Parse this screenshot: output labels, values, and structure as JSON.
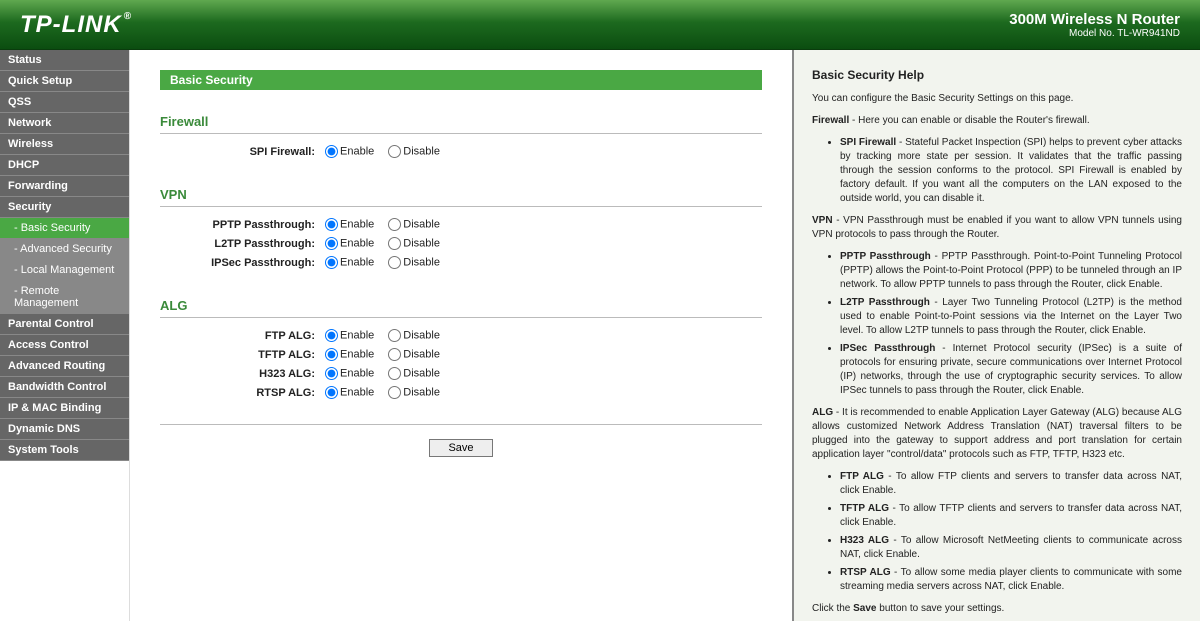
{
  "header": {
    "logo_text": "TP-LINK",
    "reg": "®",
    "product_name": "300M Wireless N Router",
    "model_no": "Model No. TL-WR941ND"
  },
  "sidebar": {
    "items": [
      {
        "label": "Status"
      },
      {
        "label": "Quick Setup"
      },
      {
        "label": "QSS"
      },
      {
        "label": "Network"
      },
      {
        "label": "Wireless"
      },
      {
        "label": "DHCP"
      },
      {
        "label": "Forwarding"
      },
      {
        "label": "Security"
      },
      {
        "label": "- Basic Security",
        "sub": true,
        "active": true
      },
      {
        "label": "- Advanced Security",
        "sub": true
      },
      {
        "label": "- Local Management",
        "sub": true
      },
      {
        "label": "- Remote Management",
        "sub": true
      },
      {
        "label": "Parental Control"
      },
      {
        "label": "Access Control"
      },
      {
        "label": "Advanced Routing"
      },
      {
        "label": "Bandwidth Control"
      },
      {
        "label": "IP & MAC Binding"
      },
      {
        "label": "Dynamic DNS"
      },
      {
        "label": "System Tools"
      }
    ]
  },
  "main": {
    "page_title": "Basic Security",
    "enable_label": "Enable",
    "disable_label": "Disable",
    "save_label": "Save",
    "sections": [
      {
        "title": "Firewall",
        "rows": [
          {
            "label": "SPI Firewall:",
            "key": "spi",
            "value": "enable"
          }
        ]
      },
      {
        "title": "VPN",
        "rows": [
          {
            "label": "PPTP Passthrough:",
            "key": "pptp",
            "value": "enable"
          },
          {
            "label": "L2TP Passthrough:",
            "key": "l2tp",
            "value": "enable"
          },
          {
            "label": "IPSec Passthrough:",
            "key": "ipsec",
            "value": "enable"
          }
        ]
      },
      {
        "title": "ALG",
        "rows": [
          {
            "label": "FTP ALG:",
            "key": "ftp",
            "value": "enable"
          },
          {
            "label": "TFTP ALG:",
            "key": "tftp",
            "value": "enable"
          },
          {
            "label": "H323 ALG:",
            "key": "h323",
            "value": "enable"
          },
          {
            "label": "RTSP ALG:",
            "key": "rtsp",
            "value": "enable"
          }
        ]
      }
    ]
  },
  "help": {
    "title": "Basic Security Help",
    "intro": "You can configure the Basic Security Settings on this page.",
    "firewall_label": "Firewall",
    "firewall_text": " - Here you can enable or disable the Router's firewall.",
    "spi_label": "SPI Firewall",
    "spi_text": " - Stateful Packet Inspection (SPI) helps to prevent cyber attacks by tracking more state per session. It validates that the traffic passing through the session conforms to the protocol. SPI Firewall is enabled by factory default. If you want all the computers on the LAN exposed to the outside world, you can disable it.",
    "vpn_label": "VPN",
    "vpn_text": " - VPN Passthrough must be enabled if you want to allow VPN tunnels using VPN protocols to pass through the Router.",
    "pptp_label": "PPTP Passthrough",
    "pptp_text": " - PPTP Passthrough. Point-to-Point Tunneling Protocol (PPTP) allows the Point-to-Point Protocol (PPP) to be tunneled through an IP network. To allow PPTP tunnels to pass through the Router, click Enable.",
    "l2tp_label": "L2TP Passthrough",
    "l2tp_text": " - Layer Two Tunneling Protocol (L2TP) is the method used to enable Point-to-Point sessions via the Internet on the Layer Two level. To allow L2TP tunnels to pass through the Router, click Enable.",
    "ipsec_label": "IPSec Passthrough",
    "ipsec_text": " - Internet Protocol security (IPSec) is a suite of protocols for ensuring private, secure communications over Internet Protocol (IP) networks, through the use of cryptographic security services. To allow IPSec tunnels to pass through the Router, click Enable.",
    "alg_label": "ALG",
    "alg_text": " - It is recommended to enable Application Layer Gateway (ALG) because ALG allows customized Network Address Translation (NAT) traversal filters to be plugged into the gateway to support address and port translation for certain application layer \"control/data\" protocols such as FTP, TFTP, H323 etc.",
    "ftp_label": "FTP ALG",
    "ftp_text": " - To allow FTP clients and servers to transfer data across NAT, click Enable.",
    "tftp_label": "TFTP ALG",
    "tftp_text": " - To allow TFTP clients and servers to transfer data across NAT, click Enable.",
    "h323_label": "H323 ALG",
    "h323_text": " - To allow Microsoft NetMeeting clients to communicate across NAT, click Enable.",
    "rtsp_label": "RTSP ALG",
    "rtsp_text": " - To allow some media player clients to communicate with some streaming media servers across NAT, click Enable.",
    "save_prefix": "Click the ",
    "save_bold": "Save",
    "save_suffix": " button to save your settings."
  }
}
